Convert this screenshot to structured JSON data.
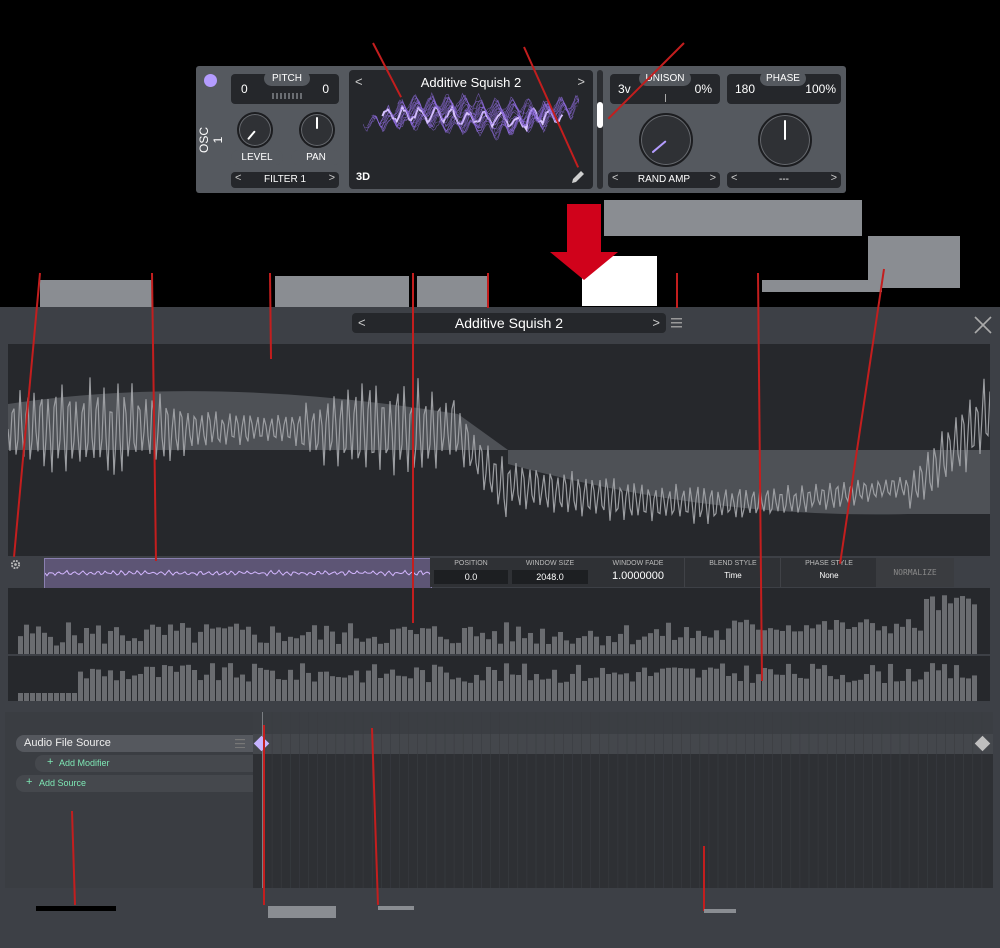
{
  "osc": {
    "side_label": "OSC 1",
    "pitch": {
      "label": "PITCH",
      "left_value": "0",
      "right_value": "0"
    },
    "level_label": "LEVEL",
    "pan_label": "PAN",
    "filter_label": "FILTER 1",
    "wavetable_name": "Additive Squish 2",
    "view_mode": "3D",
    "unison": {
      "label": "UNISON",
      "voices": "3v",
      "amount": "0%"
    },
    "phase": {
      "label": "PHASE",
      "degrees": "180",
      "amount": "100%"
    },
    "rand_amp_label": "RAND AMP",
    "phase_dropdown": "---",
    "nav_prev": "<",
    "nav_next": ">"
  },
  "editor": {
    "title": "Additive Squish 2",
    "nav_prev": "<",
    "nav_next": ">",
    "close_icon": "close-icon",
    "menu_icon": "menu-icon",
    "params": {
      "position": {
        "label": "POSITION",
        "value": "0.0"
      },
      "window_size": {
        "label": "WINDOW SIZE",
        "value": "2048.0"
      },
      "window_fade": {
        "label": "WINDOW FADE",
        "value": "1.0000000"
      },
      "blend_style": {
        "label": "BLEND STYLE",
        "value": "Time"
      },
      "phase_style": {
        "label": "PHASE STYLE",
        "value": "None"
      },
      "normalize_label": "NORMALIZE"
    },
    "sources": {
      "audio_file_source": "Audio File Source",
      "add_modifier": "Add Modifier",
      "add_source": "Add Source",
      "plus_glyph": "+"
    }
  },
  "colors": {
    "accent_purple": "#b49cff",
    "annotation_red": "#c31e1e",
    "arrow_red": "#d0021b",
    "add_green": "#7ee8b5"
  }
}
